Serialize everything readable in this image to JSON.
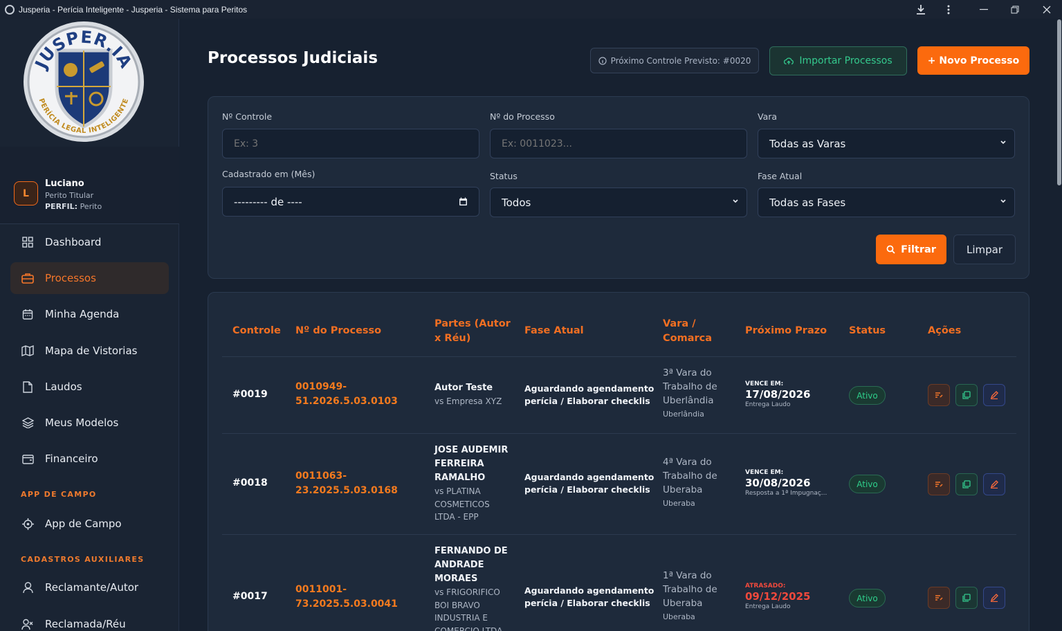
{
  "window": {
    "title": "Jusperia - Perícia Inteligente - Jusperia - Sistema para Peritos"
  },
  "brand": {
    "logo_top": "JUSPER.IA",
    "logo_bottom": "PERÍCIA LEGAL INTELIGENTE",
    "accent": "#fb6a0e"
  },
  "user": {
    "initial": "L",
    "name": "Luciano",
    "role": "Perito Titular",
    "profile_label": "PERFIL:",
    "profile_value": "Perito"
  },
  "nav": {
    "items": [
      {
        "label": "Dashboard",
        "icon": "grid-icon"
      },
      {
        "label": "Processos",
        "icon": "briefcase-icon",
        "active": true
      },
      {
        "label": "Minha Agenda",
        "icon": "calendar-icon"
      },
      {
        "label": "Mapa de Vistorias",
        "icon": "map-icon"
      },
      {
        "label": "Laudos",
        "icon": "document-icon"
      },
      {
        "label": "Meus Modelos",
        "icon": "layers-icon"
      },
      {
        "label": "Financeiro",
        "icon": "wallet-icon"
      }
    ],
    "section_field": "APP DE CAMPO",
    "field_item": "App de Campo",
    "section_aux": "CADASTROS AUXILIARES",
    "aux_items": [
      "Reclamante/Autor",
      "Reclamada/Réu"
    ]
  },
  "header": {
    "title": "Processos Judiciais",
    "next_control": "Próximo Controle Previsto: #0020",
    "import_label": "Importar Processos",
    "new_label": "+ Novo Processo"
  },
  "filters": {
    "controle_label": "Nº Controle",
    "controle_placeholder": "Ex: 3",
    "processo_label": "Nº do Processo",
    "processo_placeholder": "Ex: 0011023...",
    "vara_label": "Vara",
    "vara_value": "Todas as Varas",
    "cadastro_label": "Cadastrado em (Mês)",
    "cadastro_value": "--------- de ----",
    "status_label": "Status",
    "status_value": "Todos",
    "fase_label": "Fase Atual",
    "fase_value": "Todas as Fases",
    "filter_button": "Filtrar",
    "clear_button": "Limpar"
  },
  "table": {
    "headers": {
      "controle": "Controle",
      "processo": "Nº do Processo",
      "partes_1": "Partes (Autor",
      "partes_2": "x Réu)",
      "fase": "Fase Atual",
      "vara_1": "Vara /",
      "vara_2": "Comarca",
      "prazo": "Próximo Prazo",
      "status": "Status",
      "acoes": "Ações"
    },
    "rows": [
      {
        "controle": "#0019",
        "processo_1": "0010949-",
        "processo_2": "51.2026.5.03.0103",
        "autor": "Autor Teste",
        "reu": "vs Empresa XYZ",
        "fase_1": "Aguardando agendamento",
        "fase_2": "perícia / Elaborar checklis",
        "vara_1": "3ª Vara do",
        "vara_2": "Trabalho de",
        "vara_3": "Uberlândia",
        "comarca": "Uberlândia",
        "prazo_label": "VENCE EM:",
        "prazo_date": "17/08/2026",
        "prazo_note": "Entrega Laudo",
        "status": "Ativo"
      },
      {
        "controle": "#0018",
        "processo_1": "0011063-",
        "processo_2": "23.2025.5.03.0168",
        "autor_1": "JOSE AUDEMIR",
        "autor_2": "FERREIRA",
        "autor_3": "RAMALHO",
        "reu_1": "vs PLATINA",
        "reu_2": "COSMETICOS",
        "reu_3": "LTDA - EPP",
        "fase_1": "Aguardando agendamento",
        "fase_2": "perícia / Elaborar checklis",
        "vara_1": "4ª Vara do",
        "vara_2": "Trabalho de",
        "vara_3": "Uberaba",
        "comarca": "Uberaba",
        "prazo_label": "VENCE EM:",
        "prazo_date": "30/08/2026",
        "prazo_note": "Resposta a 1ª Impugnaç...",
        "status": "Ativo"
      },
      {
        "controle": "#0017",
        "processo_1": "0011001-",
        "processo_2": "73.2025.5.03.0041",
        "autor_1": "FERNANDO DE",
        "autor_2": "ANDRADE",
        "autor_3": "MORAES",
        "reu_1": "vs FRIGORIFICO",
        "reu_2": "BOI BRAVO",
        "reu_3": "INDUSTRIA E",
        "reu_4": "COMERCIO LTDA",
        "fase_1": "Aguardando agendamento",
        "fase_2": "perícia / Elaborar checklis",
        "vara_1": "1ª Vara do",
        "vara_2": "Trabalho de",
        "vara_3": "Uberaba",
        "comarca": "Uberaba",
        "prazo_label": "ATRASADO:",
        "prazo_date": "09/12/2025",
        "prazo_note": "Entrega Laudo",
        "status": "Ativo"
      }
    ]
  }
}
